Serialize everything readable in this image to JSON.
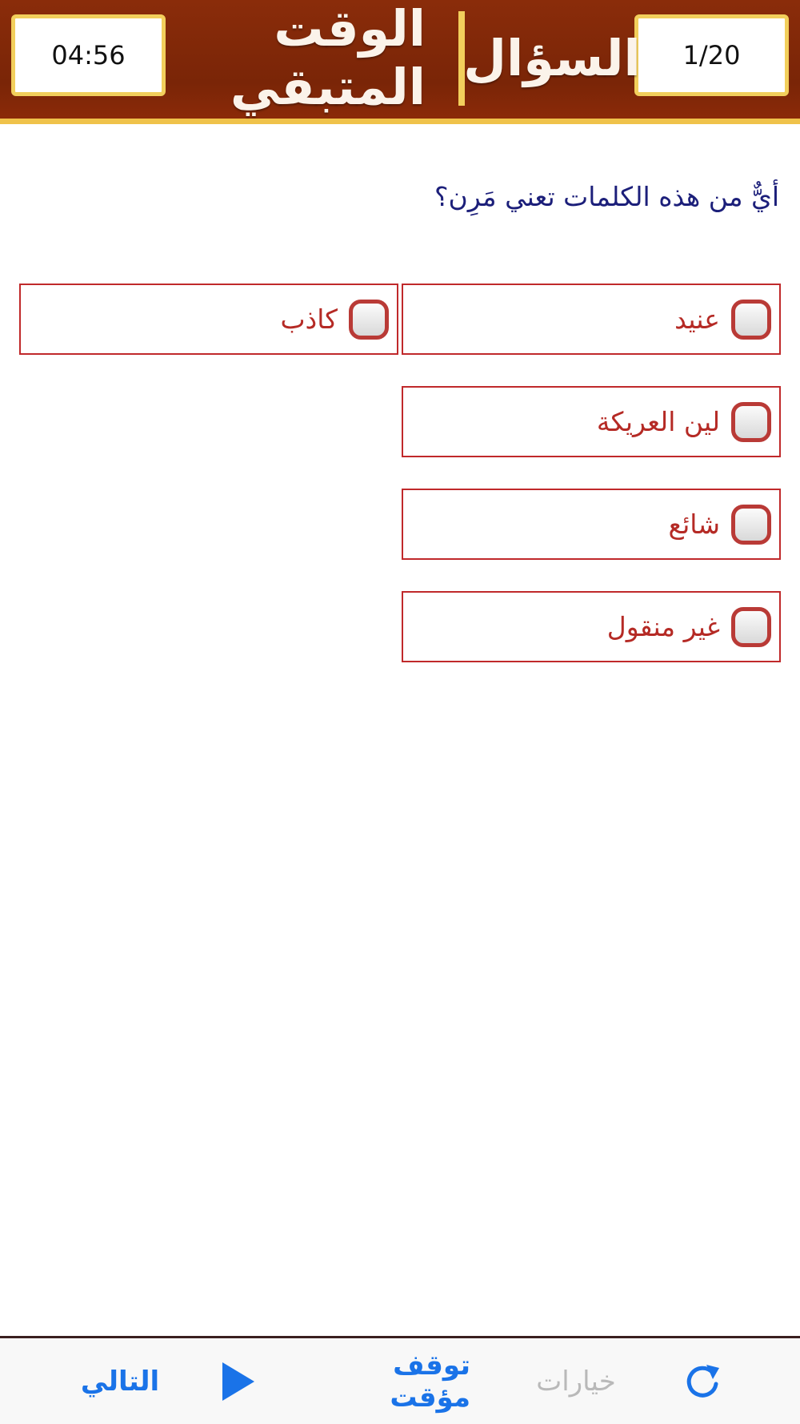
{
  "header": {
    "question_label": "السؤال",
    "question_counter": "1/20",
    "time_label": "الوقت المتبقي",
    "time_remaining": "04:56",
    "colors": {
      "background": "#7a2507",
      "accent": "#efc24a"
    }
  },
  "question": {
    "text": "أيٌّ من هذه الكلمات تعني مَرِن؟"
  },
  "answers": [
    {
      "label": "عنيد",
      "selected": false
    },
    {
      "label": "كاذب",
      "selected": false
    },
    {
      "label": "لين العريكة",
      "selected": false
    },
    {
      "label": "شائع",
      "selected": false
    },
    {
      "label": "غير منقول",
      "selected": false
    }
  ],
  "toolbar": {
    "next_label": "التالي",
    "play_icon": "play-icon",
    "pause_label": "توقف مؤقت",
    "options_label": "خيارات",
    "reload_icon": "reload-icon",
    "colors": {
      "active": "#1a73e8",
      "disabled": "#b9b9b9"
    }
  }
}
